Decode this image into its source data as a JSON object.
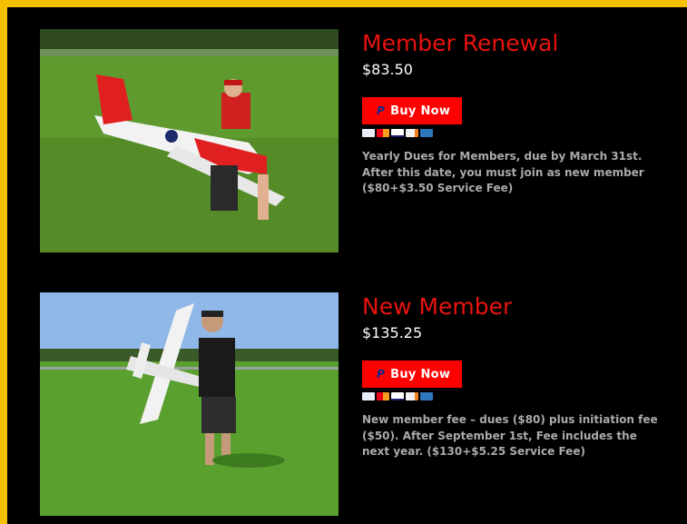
{
  "products": [
    {
      "title": "Member Renewal",
      "price": "$83.50",
      "button_label": "Buy Now",
      "payment_icons": [
        "paypal-card-icon",
        "mastercard-icon",
        "visa-icon",
        "discover-icon",
        "amex-icon"
      ],
      "description": "Yearly Dues for Members, due by March 31st. After this date, you must join as new member ($80+$3.50 Service Fee)"
    },
    {
      "title": "New Member",
      "price": "$135.25",
      "button_label": "Buy Now",
      "payment_icons": [
        "paypal-card-icon",
        "mastercard-icon",
        "visa-icon",
        "discover-icon",
        "amex-icon"
      ],
      "description": "New member fee – dues ($80) plus initiation fee ($50). After September 1st, Fee includes the next year. ($130+$5.25 Service Fee)"
    }
  ],
  "colors": {
    "page_border": "#f5c000",
    "background": "#000000",
    "title": "#e8130f",
    "button": "#ff0000",
    "description": "#aaaaaa"
  }
}
